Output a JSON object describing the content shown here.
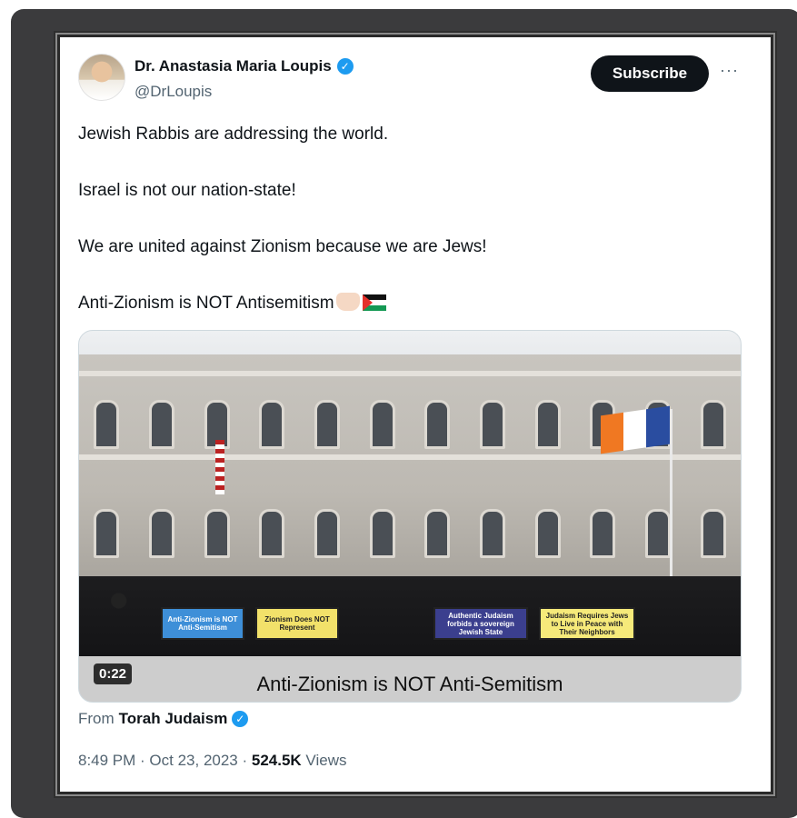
{
  "author": {
    "name": "Dr. Anastasia Maria Loupis",
    "handle": "@DrLoupis",
    "verified": true
  },
  "actions": {
    "subscribe_label": "Subscribe",
    "more_label": "···"
  },
  "tweet": {
    "paragraphs": [
      "Jewish Rabbis are addressing the world.",
      "Israel is not our nation-state!",
      "We are united against Zionism because we are Jews!",
      "Anti-Zionism is NOT Antisemitism"
    ]
  },
  "media": {
    "duration": "0:22",
    "caption": "Anti-Zionism is NOT Anti-Semitism",
    "banners": [
      "Anti-Zionism is NOT Anti-Semitism",
      "Zionism Does NOT Represent",
      "Authentic Judaism forbids a sovereign Jewish State",
      "Judaism Requires Jews to Live in Peace with Their Neighbors"
    ]
  },
  "source": {
    "prefix": "From",
    "name": "Torah Judaism",
    "verified": true
  },
  "meta": {
    "time": "8:49 PM · Oct 23, 2023 · ",
    "views_count": "524.5K",
    "views_label": " Views"
  },
  "colors": {
    "verified": "#1d9bf0",
    "text": "#0f1419",
    "muted": "#536471",
    "button_bg": "#0f1419"
  }
}
